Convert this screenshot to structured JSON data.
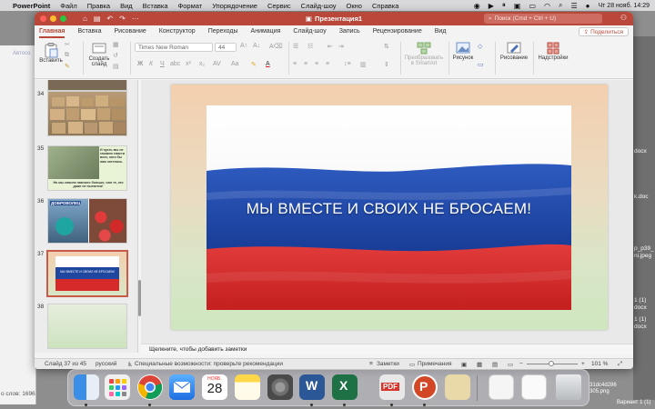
{
  "menubar": {
    "app": "PowerPoint",
    "items": [
      "Файл",
      "Правка",
      "Вид",
      "Вставка",
      "Формат",
      "Упорядочение",
      "Сервис",
      "Слайд-шоу",
      "Окно",
      "Справка"
    ],
    "clock": "Чт 28 нояб.  14:29"
  },
  "window": {
    "title": "Презентация1",
    "search_placeholder": "Поиск (Cmd + Ctrl + U)"
  },
  "ribbon_tabs": [
    "Главная",
    "Вставка",
    "Рисование",
    "Конструктор",
    "Переходы",
    "Анимация",
    "Слайд-шоу",
    "Запись",
    "Рецензирование",
    "Вид"
  ],
  "share_label": "Поделиться",
  "ribbon": {
    "paste": "Вставить",
    "new_slide_1": "Создать",
    "new_slide_2": "слайд",
    "font_name": "Times New Roman",
    "font_size": "44",
    "smartart_1": "Преобразовать",
    "smartart_2": "в SmartArt",
    "picture": "Рисунок",
    "drawing": "Рисование",
    "addins": "Надстройки"
  },
  "thumbnails": [
    {
      "num": "34"
    },
    {
      "num": "35",
      "caption_right": "И пусть мы не сможем спасти всех, кого бы нам хотелось.",
      "caption_bottom": "Но мы спасем намного больше, чем те, кто даже не пытается!"
    },
    {
      "num": "36",
      "label": "ДОБРОВОЛЕЦ"
    },
    {
      "num": "37",
      "title": "МЫ ВМЕСТЕ И СВОИХ НЕ БРОСАЕМ!"
    },
    {
      "num": "38"
    }
  ],
  "slide": {
    "title": "МЫ ВМЕСТЕ И СВОИХ НЕ БРОСАЕМ!",
    "flag_colors": [
      "#ffffff",
      "#1a3f9a",
      "#d62a2a"
    ]
  },
  "notes_placeholder": "Щелкните, чтобы добавить заметки",
  "status": {
    "slide_info": "Слайд 37 из 45",
    "language": "русский",
    "accessibility": "Специальные возможности: проверьте рекомендации",
    "notes": "Заметки",
    "comments": "Примечания",
    "zoom": "101 %"
  },
  "background": {
    "left_title": "Автосо",
    "left_status": "о слов: 1696",
    "right_files": [
      "docx",
      "k.doc",
      "p_p39_",
      "ni.jpeg",
      "1 (1)",
      "docx",
      "1 (1)",
      "docx"
    ],
    "dock_file": "31dc4d286\n305.png",
    "dock_file_right": "Вариант 1 (1)"
  },
  "dock": {
    "calendar_month": "НОЯБ.",
    "calendar_day": "28",
    "word_letter": "W",
    "excel_letter": "X",
    "pdf_label": "PDF",
    "ppt_letter": "P"
  }
}
